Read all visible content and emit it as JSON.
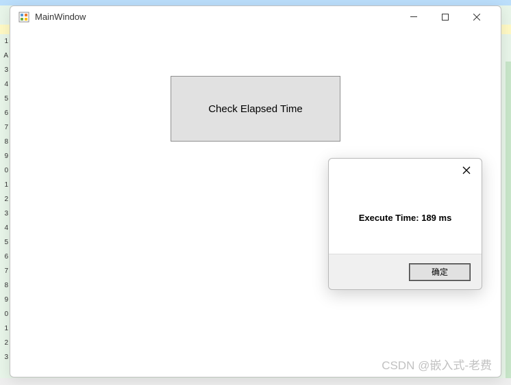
{
  "window": {
    "title": "MainWindow"
  },
  "mainButton": {
    "label": "Check Elapsed Time"
  },
  "dialog": {
    "message": "Execute Time: 189 ms",
    "okButton": "确定"
  },
  "backgroundRows": [
    "1",
    "A",
    "3",
    "4",
    "5",
    "6",
    "7",
    "8",
    "9",
    "0",
    "1",
    "2",
    "3",
    "4",
    "5",
    "6",
    "7",
    "8",
    "9",
    "0",
    "1",
    "2",
    "3"
  ],
  "watermark": "CSDN @嵌入式-老费"
}
